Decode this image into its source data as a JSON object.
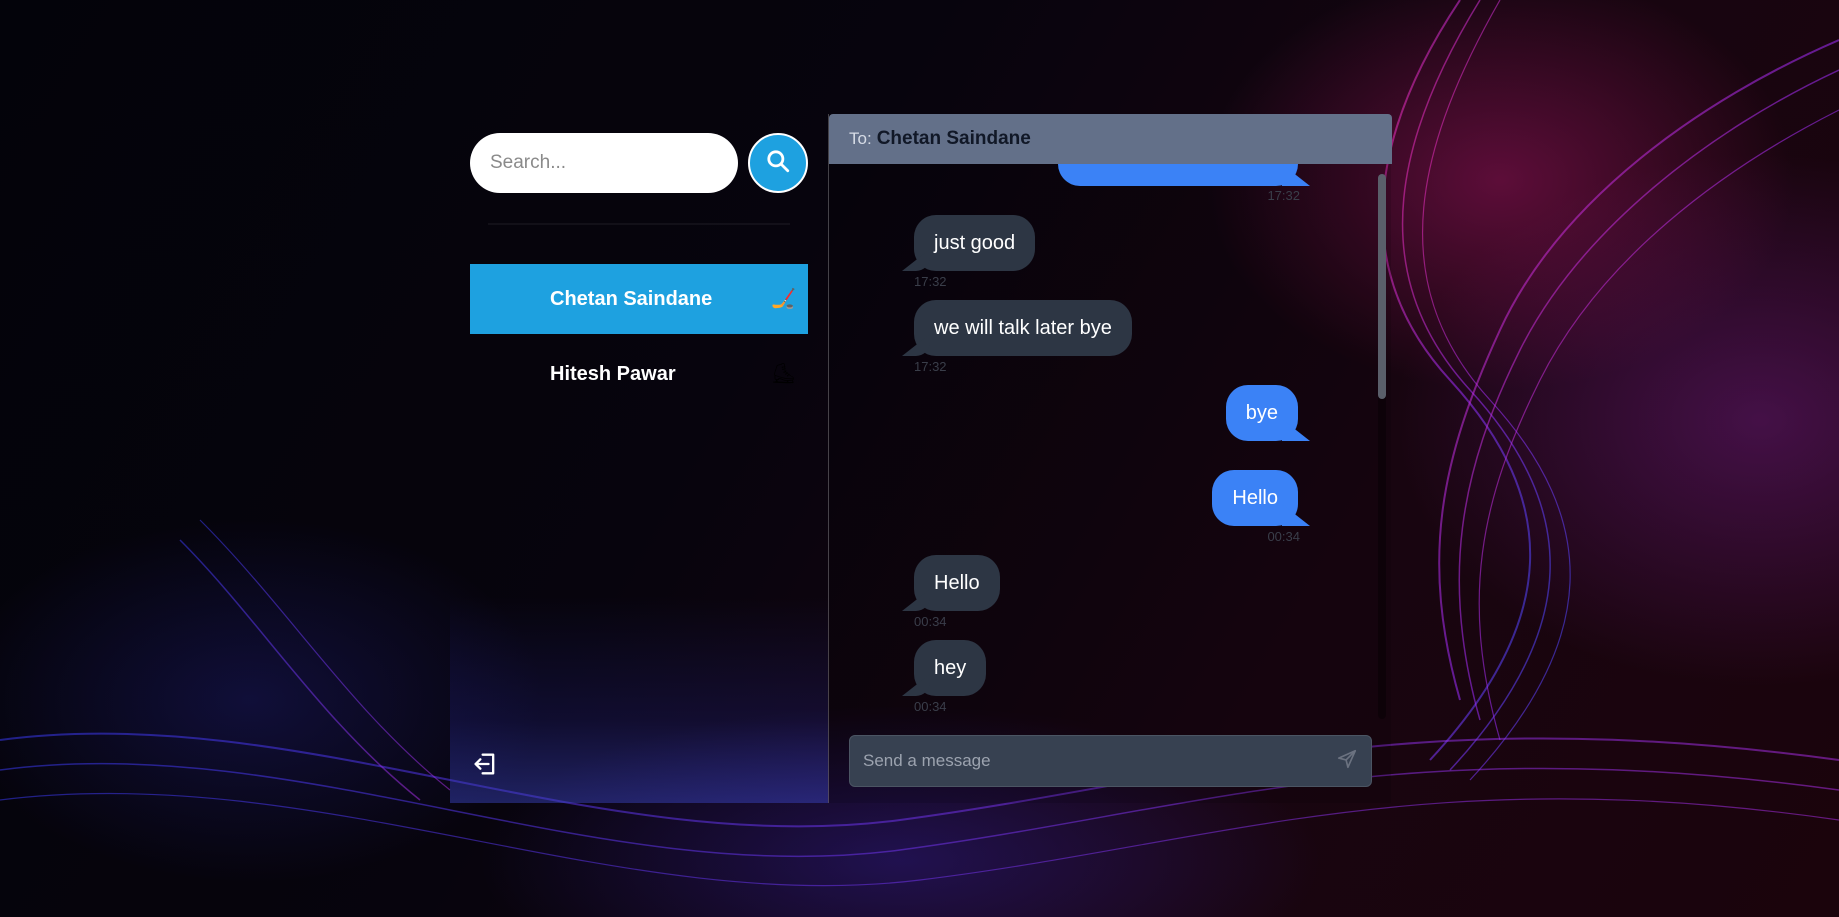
{
  "search": {
    "placeholder": "Search..."
  },
  "contacts": [
    {
      "name": "Chetan Saindane",
      "emoji": "🏒",
      "active": true
    },
    {
      "name": "Hitesh Pawar",
      "emoji": "⛸",
      "active": false
    }
  ],
  "chat": {
    "to_label": "To:",
    "to_name": "Chetan Saindane",
    "messages": [
      {
        "text": "",
        "time": "17:32",
        "direction": "sent"
      },
      {
        "text": "just good",
        "time": "17:32",
        "direction": "received"
      },
      {
        "text": "we will talk later bye",
        "time": "17:32",
        "direction": "received"
      },
      {
        "text": "bye",
        "time": "",
        "direction": "sent"
      },
      {
        "text": "Hello",
        "time": "00:34",
        "direction": "sent"
      },
      {
        "text": "Hello",
        "time": "00:34",
        "direction": "received"
      },
      {
        "text": "hey",
        "time": "00:34",
        "direction": "received"
      }
    ]
  },
  "composer": {
    "placeholder": "Send a message"
  },
  "icons": {
    "search": "search-icon",
    "logout": "logout-icon",
    "send": "send-icon"
  },
  "colors": {
    "accent": "#1ea1e0",
    "sent_bubble": "#3b82f6",
    "received_bubble": "#2d3644",
    "header": "#637089"
  }
}
